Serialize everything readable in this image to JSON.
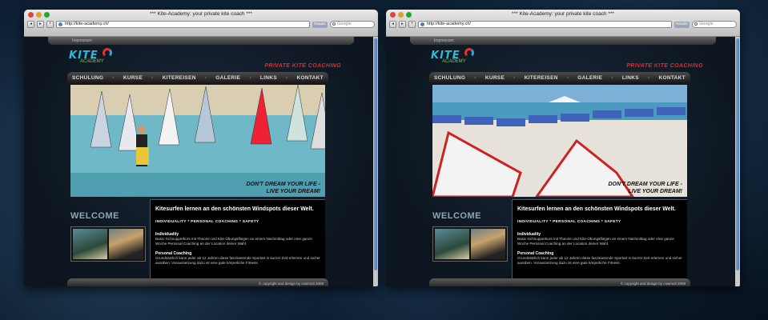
{
  "windows": [
    {
      "title": "*** Kite-Academy: your private kite coach ***",
      "url": "http://kite-academy.ch/",
      "search_placeholder": "Google",
      "reader_label": "Reader",
      "impressum": "Impressum",
      "logo_kite": "KITE",
      "logo_academy": "ACADEMY",
      "tagline": "PRIVATE KITE COACHING",
      "menu": [
        "SCHULUNG",
        "KURSE",
        "KITEREISEN",
        "GALERIE",
        "LINKS",
        "KONTAKT"
      ],
      "slogan_line1": "DON'T DREAM YOUR LIFE -",
      "slogan_line2": "LIVE YOUR DREAM!",
      "welcome": "WELCOME",
      "headline": "Kitesurfen lernen an den schönsten Windspots dieser Welt.",
      "tags": "INDIVIDUALITY * PERSONAL COACHING * SAFETY",
      "section1_title": "Individuality",
      "section1_text": "Basic-Schnupperkurs mit Theorie und Kite-Übungsfliegen an einem Nachmittag oder eine ganze Woche Personal Coaching an der Location deiner Wahl.",
      "section2_title": "Personal Coaching",
      "section2_text": "Grundsätzlich kann jeder ab 12 Jahren diese faszinierende Sportart in kurzer Zeit erlernen und sicher ausüben. Voraussetzung dazu ist eine gute körperliche Fitness.",
      "copyright": "© copyright and design by cowmoti 2009",
      "hero": "windsurf"
    },
    {
      "title": "*** Kite-Academy: your private kite coach ***",
      "url": "http://kite-academy.ch/",
      "search_placeholder": "Google",
      "reader_label": "Reader",
      "impressum": "Impressum",
      "logo_kite": "KITE",
      "logo_academy": "ACADEMY",
      "tagline": "PRIVATE KITE COACHING",
      "menu": [
        "SCHULUNG",
        "KURSE",
        "KITEREISEN",
        "GALERIE",
        "LINKS",
        "KONTAKT"
      ],
      "slogan_line1": "DON'T DREAM YOUR LIFE -",
      "slogan_line2": "LIVE YOUR DREAM!",
      "welcome": "WELCOME",
      "headline": "Kitesurfen lernen an den schönsten Windspots dieser Welt.",
      "tags": "INDIVIDUALITY * PERSONAL COACHING * SAFETY",
      "section1_title": "Individuality",
      "section1_text": "Basic-Schnupperkurs mit Theorie und Kite-Übungsfliegen an einem Nachmittag oder eine ganze Woche Personal Coaching an der Location deiner Wahl.",
      "section2_title": "Personal Coaching",
      "section2_text": "Grundsätzlich kann jeder ab 12 Jahren diese faszinierende Sportart in kurzer Zeit erlernen und sicher ausüben. Voraussetzung dazu ist eine gute körperliche Fitness.",
      "copyright": "© copyright and design by cowmoti 2009",
      "hero": "beach"
    }
  ],
  "colors": {
    "accent_red": "#e22233",
    "logo_blue": "#2fb7d8",
    "logo_green": "#7ec83b",
    "welcome_gray": "#8fa7b7"
  }
}
